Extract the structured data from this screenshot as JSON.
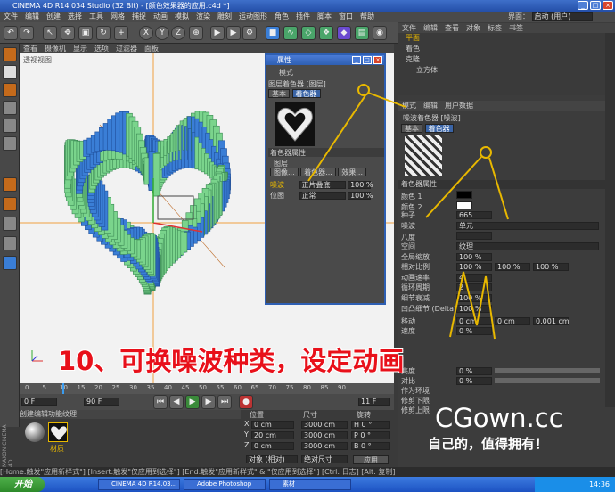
{
  "window": {
    "title": "CINEMA 4D R14.034 Studio (32 Bit) - [颜色效果器的应用.c4d *]",
    "layout_label": "界面：",
    "layout_value": "启动 (用户)"
  },
  "menu": [
    "文件",
    "编辑",
    "创建",
    "选择",
    "工具",
    "网格",
    "捕捉",
    "动画",
    "模拟",
    "渲染",
    "雕刻",
    "运动图形",
    "角色",
    "插件",
    "脚本",
    "窗口",
    "帮助"
  ],
  "viewport_menu": [
    "查看",
    "摄像机",
    "显示",
    "选项",
    "过滤器",
    "面板"
  ],
  "viewport_label": "透视视图",
  "object_manager": {
    "menu": [
      "文件",
      "编辑",
      "查看",
      "对象",
      "标签",
      "书签"
    ],
    "rows": [
      "平面",
      "着色",
      "克隆",
      "立方体"
    ]
  },
  "attr_dialog": {
    "title": "属性",
    "mode_label": "模式",
    "shader_label": "图层着色器 [图层]",
    "tabs": [
      "基本",
      "着色器"
    ],
    "section": "着色器属性",
    "sub": "图层",
    "buttons": [
      "图像...",
      "着色器...",
      "效果..."
    ],
    "layers": [
      {
        "name": "噪波",
        "mode": "正片叠底",
        "value": "100 %"
      },
      {
        "name": "位图",
        "mode": "正常",
        "value": "100 %"
      }
    ]
  },
  "attr_manager": {
    "menu": [
      "模式",
      "编辑",
      "用户数据"
    ],
    "shader_label": "噪波着色器 [噪波]",
    "tabs": [
      "基本",
      "着色器"
    ],
    "section": "着色器属性",
    "params": [
      {
        "label": "颜色 1",
        "value": ""
      },
      {
        "label": "颜色 2",
        "value": ""
      },
      {
        "label": "种子",
        "value": "665"
      },
      {
        "label": "噪波",
        "value": "单元"
      },
      {
        "label": "八度",
        "value": ""
      },
      {
        "label": "空间",
        "value": "纹理"
      },
      {
        "label": "全局缩放",
        "value": "100 %"
      },
      {
        "label": "相对比例",
        "value": "100 %"
      },
      {
        "label": "动画速率",
        "value": "4"
      },
      {
        "label": "循环周期",
        "value": "2"
      },
      {
        "label": "细节衰减",
        "value": "100 %"
      },
      {
        "label": "凹凸细节 (Delta)",
        "value": "100 %"
      },
      {
        "label": "移动",
        "value": "0 cm"
      },
      {
        "label": "速度",
        "value": "0 %"
      }
    ],
    "relative_extra": [
      "100 %",
      "100 %"
    ],
    "move_extra": [
      "0 cm",
      "0.001 cm"
    ],
    "lower_rows": [
      "亮度",
      "对比",
      "作为环境",
      "修剪下限",
      "修剪上限"
    ],
    "lower_values": [
      "0 %",
      "0 %"
    ]
  },
  "timeline": {
    "ticks": [
      "0",
      "5",
      "10",
      "15",
      "20",
      "25",
      "30",
      "35",
      "40",
      "45",
      "50",
      "55",
      "60",
      "65",
      "70",
      "75",
      "80",
      "85",
      "90"
    ],
    "frame": "11 F",
    "start": "0 F",
    "end": "90 F"
  },
  "materials": {
    "menu": [
      "创建",
      "编辑",
      "功能",
      "纹理"
    ],
    "items": [
      "",
      "材质"
    ]
  },
  "coords": {
    "headers": [
      "位置",
      "尺寸",
      "旋转"
    ],
    "rows": [
      {
        "axis": "X",
        "pos": "0 cm",
        "size": "3000 cm",
        "rot": "H 0 °"
      },
      {
        "axis": "Y",
        "pos": "20 cm",
        "size": "3000 cm",
        "rot": "P 0 °"
      },
      {
        "axis": "Z",
        "pos": "0 cm",
        "size": "3000 cm",
        "rot": "B 0 °"
      }
    ],
    "mode1": "对象 (相对)",
    "mode2": "绝对尺寸",
    "apply": "应用"
  },
  "statusbar": "[Home:触发\"应用新样式\"] [Insert:触发\"仅应用到选择\"] [End:触发\"应用新样式\" & \"仅应用到选择\"] [Ctrl: 日志] [Alt: 复制]",
  "taskbar": {
    "start": "开始",
    "tasks": [
      "CINEMA 4D R14.03...",
      "Adobe Photoshop",
      "素材"
    ],
    "clock": "14:36"
  },
  "caption": "10、可换噪波种类，设定动画",
  "brand": "CGown.cc",
  "slogan": "自己的，值得拥有！",
  "maxon": "MAXON CINEMA 4D",
  "colors": {
    "caption": "#e8101a",
    "arrow": "#e8b800",
    "cube_green": "#7ad48c",
    "cube_blue": "#3a7ed6"
  }
}
